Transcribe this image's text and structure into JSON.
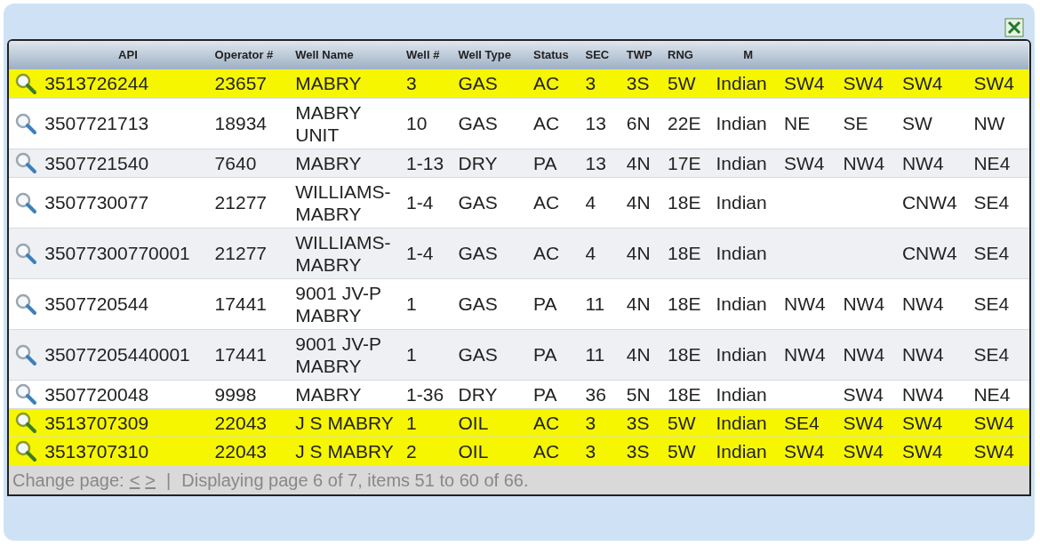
{
  "table": {
    "columns": [
      "API",
      "Operator #",
      "Well Name",
      "Well #",
      "Well Type",
      "Status",
      "SEC",
      "TWP",
      "RNG",
      "M"
    ],
    "rows": [
      {
        "highlighted": true,
        "cells": [
          "3513726244",
          "23657",
          "MABRY",
          "3",
          "GAS",
          "AC",
          "3",
          "3S",
          "5W",
          "Indian",
          "SW4",
          "SW4",
          "SW4",
          "SW4"
        ]
      },
      {
        "highlighted": false,
        "cells": [
          "3507721713",
          "18934",
          "MABRY UNIT",
          "10",
          "GAS",
          "AC",
          "13",
          "6N",
          "22E",
          "Indian",
          "NE",
          "SE",
          "SW",
          "NW"
        ]
      },
      {
        "highlighted": false,
        "cells": [
          "3507721540",
          "7640",
          "MABRY",
          "1-13",
          "DRY",
          "PA",
          "13",
          "4N",
          "17E",
          "Indian",
          "SW4",
          "NW4",
          "NW4",
          "NE4"
        ]
      },
      {
        "highlighted": false,
        "cells": [
          "3507730077",
          "21277",
          "WILLIAMS-MABRY",
          "1-4",
          "GAS",
          "AC",
          "4",
          "4N",
          "18E",
          "Indian",
          "",
          "",
          "CNW4",
          "SE4"
        ]
      },
      {
        "highlighted": false,
        "cells": [
          "35077300770001",
          "21277",
          "WILLIAMS-MABRY",
          "1-4",
          "GAS",
          "AC",
          "4",
          "4N",
          "18E",
          "Indian",
          "",
          "",
          "CNW4",
          "SE4"
        ]
      },
      {
        "highlighted": false,
        "cells": [
          "3507720544",
          "17441",
          "9001 JV-P MABRY",
          "1",
          "GAS",
          "PA",
          "11",
          "4N",
          "18E",
          "Indian",
          "NW4",
          "NW4",
          "NW4",
          "SE4"
        ]
      },
      {
        "highlighted": false,
        "cells": [
          "35077205440001",
          "17441",
          "9001 JV-P MABRY",
          "1",
          "GAS",
          "PA",
          "11",
          "4N",
          "18E",
          "Indian",
          "NW4",
          "NW4",
          "NW4",
          "SE4"
        ]
      },
      {
        "highlighted": false,
        "cells": [
          "3507720048",
          "9998",
          "MABRY",
          "1-36",
          "DRY",
          "PA",
          "36",
          "5N",
          "18E",
          "Indian",
          "",
          "SW4",
          "NW4",
          "NE4"
        ]
      },
      {
        "highlighted": true,
        "cells": [
          "3513707309",
          "22043",
          "J S MABRY",
          "1",
          "OIL",
          "AC",
          "3",
          "3S",
          "5W",
          "Indian",
          "SE4",
          "SW4",
          "SW4",
          "SW4"
        ]
      },
      {
        "highlighted": true,
        "cells": [
          "3513707310",
          "22043",
          "J S MABRY",
          "2",
          "OIL",
          "AC",
          "3",
          "3S",
          "5W",
          "Indian",
          "SW4",
          "SW4",
          "SW4",
          "SW4"
        ]
      }
    ]
  },
  "pager": {
    "label": "Change page:",
    "prev": "<",
    "next": ">",
    "separator": "|",
    "status": "Displaying page 6 of 7, items 51 to 60 of 66."
  }
}
